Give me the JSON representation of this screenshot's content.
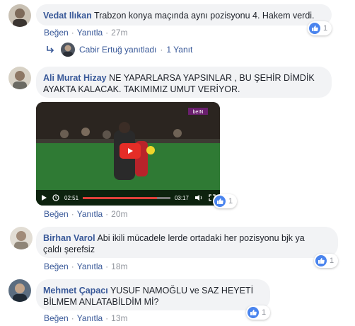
{
  "comments": [
    {
      "author": "Vedat Ilıkan",
      "text": "Trabzon konya maçında aynı pozisyonu 4. Hakem verdi.",
      "like_action": "Beğen",
      "reply_action": "Yanıtla",
      "time": "27m",
      "reactions": "1",
      "reply_summary": {
        "text": "Cabir Ertuğ yanıtladı",
        "count": "1 Yanıt"
      }
    },
    {
      "author": "Ali Murat Hizay",
      "text_line1": "NE YAPARLARSA YAPSINLAR , BU ŞEHİR DİMDİK",
      "text_line2": "AYAKTA KALACAK. TAKIMIMIZ UMUT VERİYOR.",
      "like_action": "Beğen",
      "reply_action": "Yanıtla",
      "time": "20m",
      "reactions": "1",
      "video": {
        "current_time": "02:51",
        "duration": "03:17",
        "progress": 0.85,
        "badge": "beIN"
      }
    },
    {
      "author": "Birhan Varol",
      "text_line1": "Abi ikili mücadele lerde ortadaki her pozisyonu bjk ya",
      "text_line2": "çaldı şerefsiz",
      "like_action": "Beğen",
      "reply_action": "Yanıtla",
      "time": "18m",
      "reactions": "1"
    },
    {
      "author": "Mehmet Çapacı",
      "text_line1": "YUSUF NAMOĞLU ve SAZ HEYETİ",
      "text_line2": "BİLMEM ANLATABİLDİM Mİ?",
      "like_action": "Beğen",
      "reply_action": "Yanıtla",
      "time": "13m",
      "reactions": "1"
    }
  ],
  "separator": "·",
  "colors": {
    "author": "#385898",
    "bubble": "#f2f3f5",
    "like_badge": "#4a84ee",
    "muted": "#90949c"
  }
}
